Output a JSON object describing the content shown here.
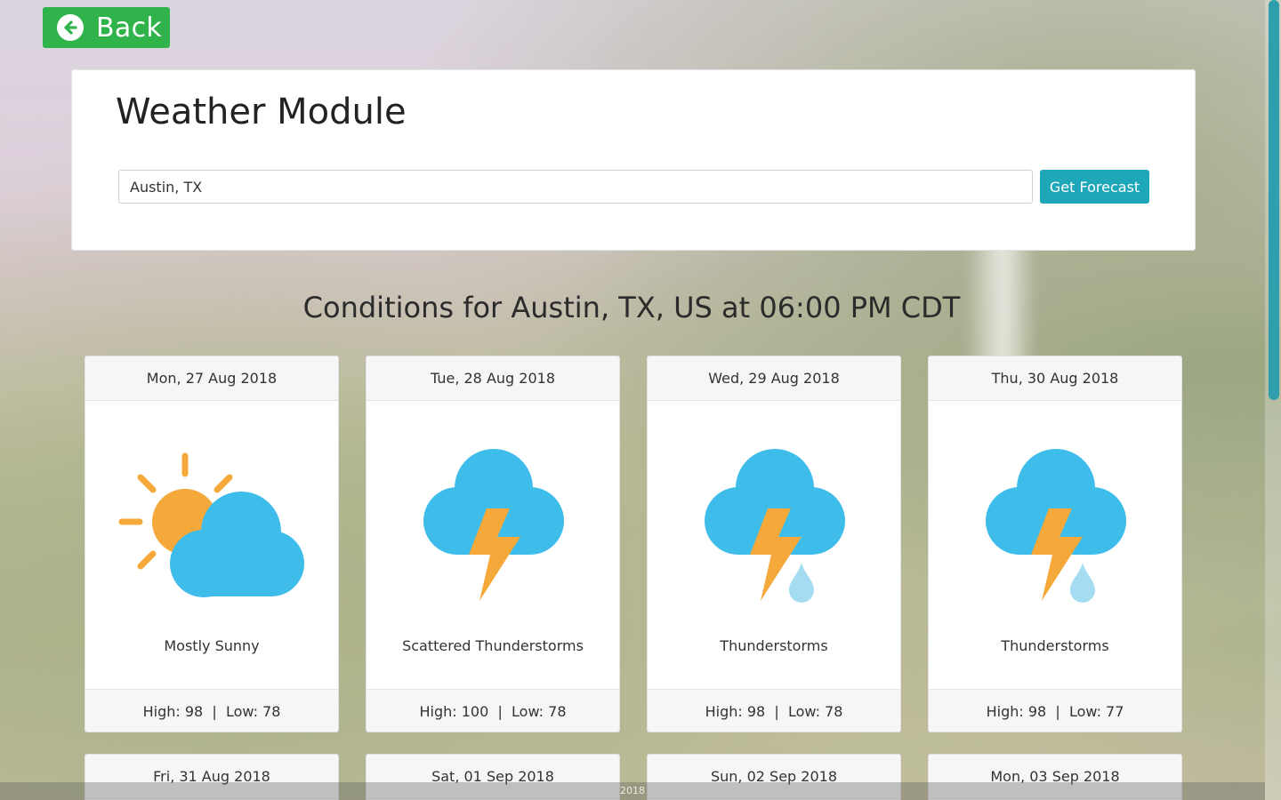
{
  "back_button": {
    "label": "Back",
    "icon": "arrow-left-circle-icon"
  },
  "search": {
    "title": "Weather Module",
    "input_value": "Austin, TX",
    "button_label": "Get Forecast"
  },
  "conditions_title": "Conditions for Austin, TX, US at 06:00 PM CDT",
  "days": [
    {
      "date": "Mon, 27 Aug 2018",
      "icon": "partly-sunny-icon",
      "condition": "Mostly Sunny",
      "high": "High: 98",
      "low": "Low: 78"
    },
    {
      "date": "Tue, 28 Aug 2018",
      "icon": "thunderstorm-icon",
      "condition": "Scattered Thunderstorms",
      "high": "High: 100",
      "low": "Low: 78"
    },
    {
      "date": "Wed, 29 Aug 2018",
      "icon": "thunderstorm-rain-icon",
      "condition": "Thunderstorms",
      "high": "High: 98",
      "low": "Low: 78"
    },
    {
      "date": "Thu, 30 Aug 2018",
      "icon": "thunderstorm-rain-icon",
      "condition": "Thunderstorms",
      "high": "High: 98",
      "low": "Low: 77"
    },
    {
      "date": "Fri, 31 Aug 2018"
    },
    {
      "date": "Sat, 01 Sep 2018"
    },
    {
      "date": "Sun, 02 Sep 2018"
    },
    {
      "date": "Mon, 03 Sep 2018"
    }
  ],
  "footer_year": "2018",
  "colors": {
    "back_green": "#2fb34a",
    "accent_teal": "#1ea7b8",
    "cloud_blue": "#3fbdea",
    "sun_orange": "#f6a93b",
    "rain_drop": "#a6dcf1"
  }
}
